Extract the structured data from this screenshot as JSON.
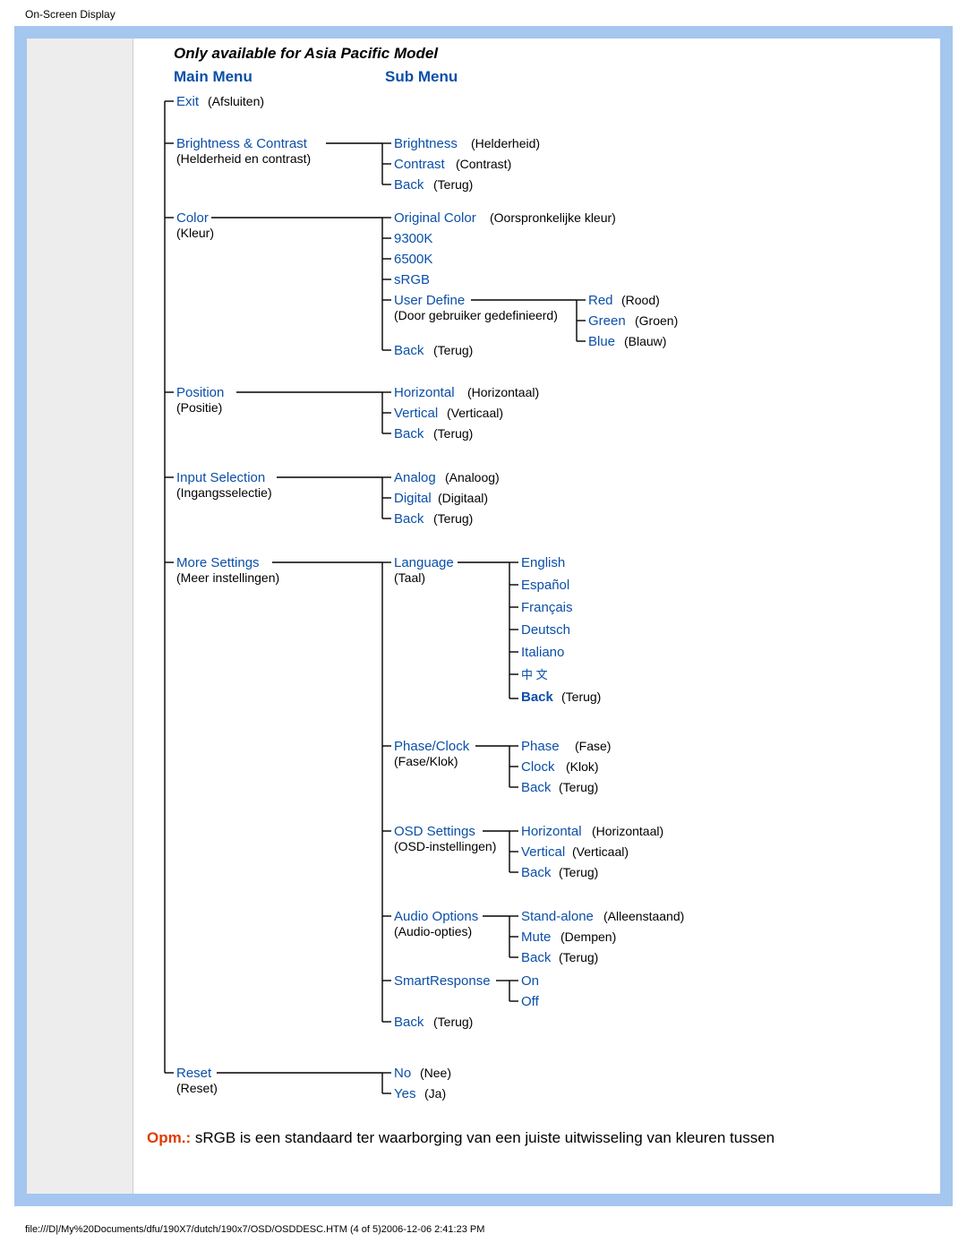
{
  "page_title": "On-Screen Display",
  "diagram_header": "Only available for Asia Pacific Model",
  "columns": {
    "main": "Main Menu",
    "sub": "Sub Menu"
  },
  "main": {
    "exit": {
      "en": "Exit",
      "tr": "(Afsluiten)"
    },
    "brightness": {
      "en": "Brightness &  Contrast",
      "tr": "(Helderheid en contrast)"
    },
    "color": {
      "en": "Color",
      "tr": "(Kleur)"
    },
    "position": {
      "en": "Position",
      "tr": "(Positie)"
    },
    "input": {
      "en": "Input Selection",
      "tr": "(Ingangsselectie)"
    },
    "more": {
      "en": "More Settings",
      "tr": "(Meer instellingen)"
    },
    "reset": {
      "en": "Reset",
      "tr": "(Reset)"
    }
  },
  "sub_brightness": {
    "bright": {
      "en": "Brightness",
      "tr": "(Helderheid)"
    },
    "cont": {
      "en": "Contrast",
      "tr": "(Contrast)"
    },
    "back": {
      "en": "Back",
      "tr": "(Terug)"
    }
  },
  "sub_color": {
    "orig": {
      "en": "Original Color",
      "tr": "(Oorspronkelijke kleur)"
    },
    "k9300": {
      "en": "9300K"
    },
    "k6500": {
      "en": "6500K"
    },
    "srgb": {
      "en": "sRGB"
    },
    "user": {
      "en": "User Define",
      "tr": "(Door gebruiker gedefinieerd)"
    },
    "back": {
      "en": "Back",
      "tr": "(Terug)"
    }
  },
  "sub_color_rgb": {
    "red": {
      "en": "Red",
      "tr": "(Rood)"
    },
    "green": {
      "en": "Green",
      "tr": "(Groen)"
    },
    "blue": {
      "en": "Blue",
      "tr": "(Blauw)"
    }
  },
  "sub_position": {
    "h": {
      "en": "Horizontal",
      "tr": "(Horizontaal)"
    },
    "v": {
      "en": "Vertical",
      "tr": "(Verticaal)"
    },
    "back": {
      "en": "Back",
      "tr": "(Terug)"
    }
  },
  "sub_input": {
    "ana": {
      "en": "Analog",
      "tr": "(Analoog)"
    },
    "dig": {
      "en": "Digital",
      "tr": "(Digitaal)"
    },
    "back": {
      "en": "Back",
      "tr": "(Terug)"
    }
  },
  "sub_more": {
    "lang": {
      "en": "Language",
      "tr": "(Taal)"
    },
    "phase": {
      "en": "Phase/Clock",
      "tr": "(Fase/Klok)"
    },
    "osd": {
      "en": "OSD Settings",
      "tr": "(OSD-instellingen)"
    },
    "audio": {
      "en": "Audio Options",
      "tr": "(Audio-opties)"
    },
    "smart": {
      "en": "SmartResponse"
    },
    "back": {
      "en": "Back",
      "tr": "(Terug)"
    }
  },
  "sub_lang": {
    "en": "English",
    "es": "Español",
    "fr": "Français",
    "de": "Deutsch",
    "it": "Italiano",
    "zh": "中 文",
    "back": {
      "en": "Back",
      "tr": "(Terug)"
    }
  },
  "sub_phase": {
    "phase": {
      "en": "Phase",
      "tr": "(Fase)"
    },
    "clock": {
      "en": "Clock",
      "tr": "(Klok)"
    },
    "back": {
      "en": "Back",
      "tr": "(Terug)"
    }
  },
  "sub_osd": {
    "h": {
      "en": "Horizontal",
      "tr": "(Horizontaal)"
    },
    "v": {
      "en": "Vertical",
      "tr": "(Verticaal)"
    },
    "back": {
      "en": "Back",
      "tr": "(Terug)"
    }
  },
  "sub_audio": {
    "stand": {
      "en": "Stand-alone",
      "tr": "(Alleenstaand)"
    },
    "mute": {
      "en": "Mute",
      "tr": "(Dempen)"
    },
    "back": {
      "en": "Back",
      "tr": "(Terug)"
    }
  },
  "sub_smart": {
    "on": "On",
    "off": "Off"
  },
  "sub_reset": {
    "no": {
      "en": "No",
      "tr": "(Nee)"
    },
    "yes": {
      "en": "Yes",
      "tr": "(Ja)"
    }
  },
  "note": {
    "label": "Opm.:",
    "text": " sRGB is een standaard ter waarborging van een juiste uitwisseling van kleuren tussen"
  },
  "footer": "file:///D|/My%20Documents/dfu/190X7/dutch/190x7/OSD/OSDDESC.HTM (4 of 5)2006-12-06 2:41:23 PM"
}
